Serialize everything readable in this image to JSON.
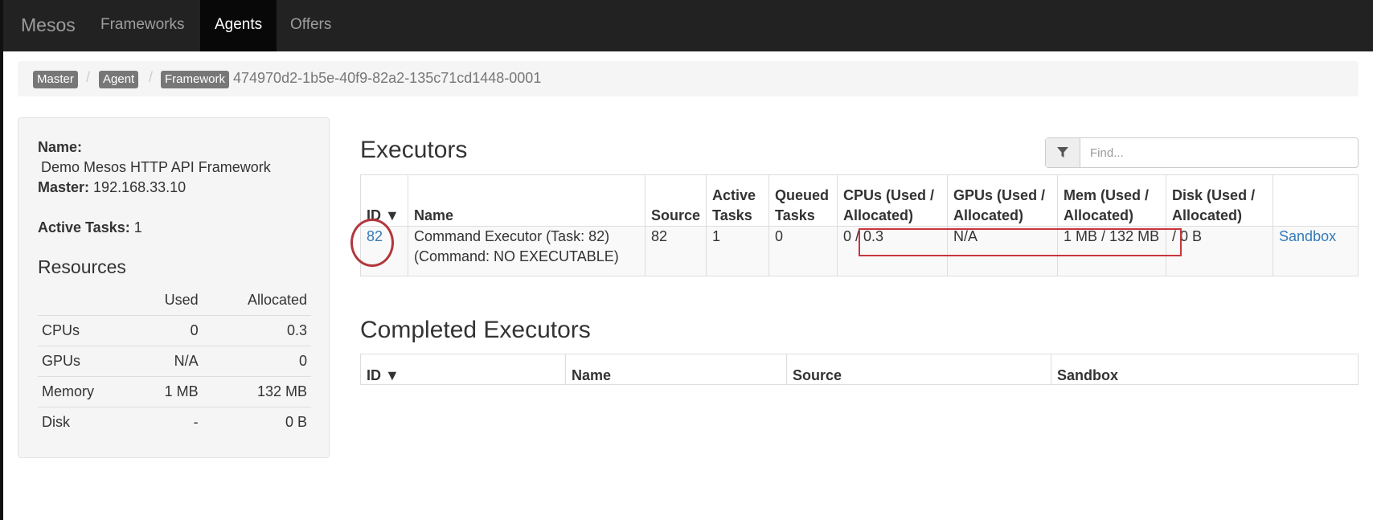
{
  "nav": {
    "brand": "Mesos",
    "items": [
      {
        "label": "Frameworks"
      },
      {
        "label": "Agents"
      },
      {
        "label": "Offers"
      }
    ]
  },
  "breadcrumb": {
    "master": "Master",
    "agent": "Agent",
    "framework": "Framework",
    "framework_id": "474970d2-1b5e-40f9-82a2-135c71cd1448-0001",
    "separator": "/"
  },
  "summary": {
    "name_label": "Name:",
    "name_value": "Demo Mesos HTTP API Framework",
    "master_label": "Master:",
    "master_value": "192.168.33.10",
    "active_tasks_label": "Active Tasks:",
    "active_tasks_value": "1",
    "resources_title": "Resources",
    "resources_headers": [
      "",
      "Used",
      "Allocated"
    ],
    "resources": [
      {
        "name": "CPUs",
        "used": "0",
        "allocated": "0.3"
      },
      {
        "name": "GPUs",
        "used": "N/A",
        "allocated": "0"
      },
      {
        "name": "Memory",
        "used": "1 MB",
        "allocated": "132 MB"
      },
      {
        "name": "Disk",
        "used": "-",
        "allocated": "0 B"
      }
    ]
  },
  "executors": {
    "title": "Executors",
    "filter_placeholder": "Find...",
    "headers": {
      "id": "ID ▼",
      "name": "Name",
      "source": "Source",
      "active_tasks_1": "Active",
      "active_tasks_2": "Tasks",
      "queued_tasks_1": "Queued",
      "queued_tasks_2": "Tasks",
      "cpus_1": "CPUs (Used /",
      "cpus_2": "Allocated)",
      "gpus_1": "GPUs (Used /",
      "gpus_2": "Allocated)",
      "mem_1": "Mem (Used /",
      "mem_2": "Allocated)",
      "disk_1": "Disk (Used /",
      "disk_2": "Allocated)"
    },
    "rows": [
      {
        "id": "82",
        "name_1": "Command Executor (Task: 82)",
        "name_2": "(Command: NO EXECUTABLE)",
        "source": "82",
        "active": "1",
        "queued": "0",
        "cpus": "0 / 0.3",
        "gpus": "N/A",
        "mem": "1 MB / 132 MB",
        "disk": "/ 0 B",
        "sandbox": "Sandbox"
      }
    ]
  },
  "completed": {
    "title": "Completed Executors",
    "headers": {
      "id": "ID ▼",
      "name": "Name",
      "source": "Source",
      "sandbox": "Sandbox"
    }
  },
  "colors": {
    "navbar": "#222222",
    "link": "#337ab7",
    "annotation": "#c9353d"
  },
  "icons": {
    "filter": "filter-icon"
  }
}
